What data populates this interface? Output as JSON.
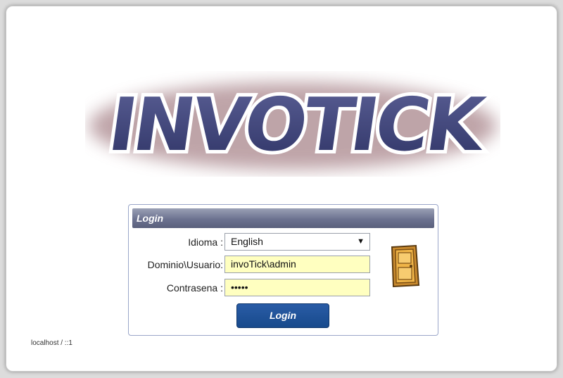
{
  "logo": {
    "text": "INVOTICK"
  },
  "login": {
    "title": "Login",
    "language_label": "Idioma :",
    "language_value": "English",
    "user_label": "Dominio\\Usuario:",
    "user_value": "invoTick\\admin",
    "password_label": "Contrasena :",
    "password_value": "•••••",
    "button_label": "Login"
  },
  "footer": {
    "host": "localhost / ::1"
  }
}
